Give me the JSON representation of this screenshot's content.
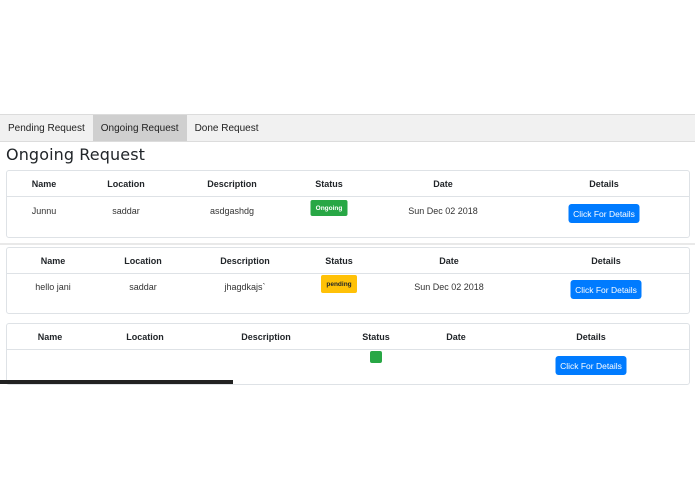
{
  "tabs": [
    "Pending Request",
    "Ongoing Request",
    "Done Request"
  ],
  "heading": "Ongoing Request",
  "headers": [
    "Name",
    "Location",
    "Description",
    "Status",
    "Date",
    "Details"
  ],
  "rows": [
    {
      "name": "Junnu",
      "location": "saddar",
      "description": "asdgashdg",
      "status": "Ongoing",
      "date": "Sun Dec 02 2018",
      "button": "Click For Details"
    },
    {
      "name": "hello jani",
      "location": "saddar",
      "description": "jhagdkajs`",
      "status": "pending",
      "date": "Sun Dec 02 2018",
      "button": "Click For Details"
    },
    {
      "name": "",
      "location": "",
      "description": "",
      "status": "",
      "date": "",
      "button": "Click For Details"
    }
  ],
  "colors": {
    "ongoing": "#28a745",
    "pending": "#ffc107",
    "primary": "#007bff"
  }
}
